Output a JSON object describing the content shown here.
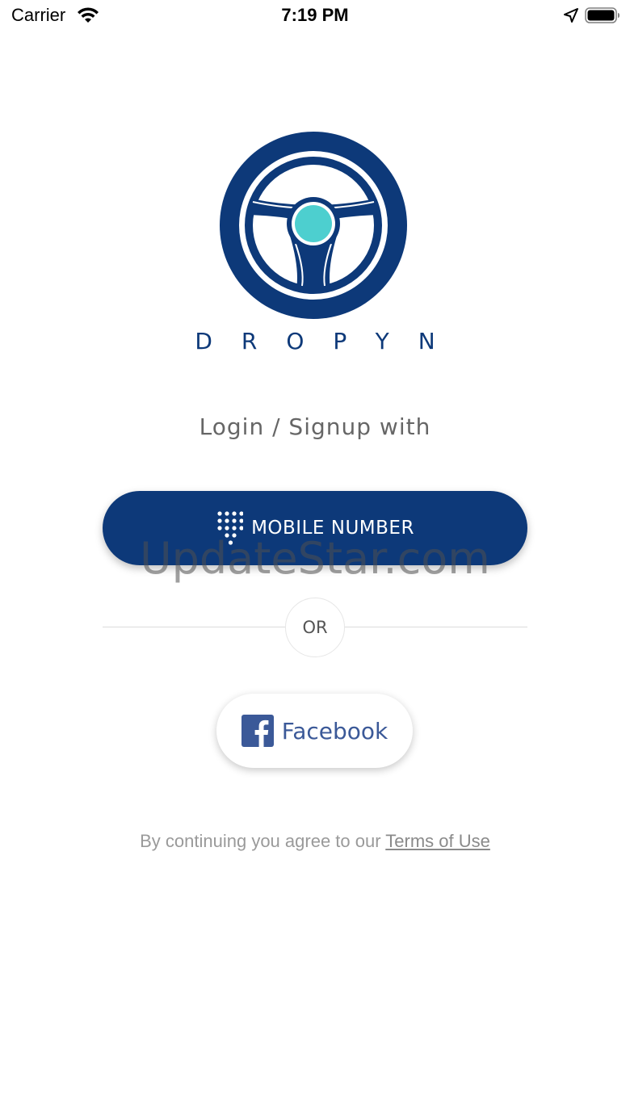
{
  "status_bar": {
    "carrier": "Carrier",
    "time": "7:19 PM",
    "icons": [
      "wifi-icon",
      "location-arrow-icon",
      "battery-icon"
    ]
  },
  "brand": {
    "name": "DROPYN",
    "logo_icon": "steering-wheel-icon",
    "primary_color": "#0d3979",
    "accent_color": "#4dcfcf"
  },
  "login": {
    "prompt": "Login / Signup with",
    "mobile_button_label": "MOBILE NUMBER",
    "mobile_button_icon": "dialpad-icon",
    "or_label": "OR",
    "facebook_button_label": "Facebook",
    "facebook_icon": "facebook-logo-icon",
    "facebook_color": "#3b5998"
  },
  "footer": {
    "terms_prefix": "By continuing you agree to our",
    "terms_link": "Terms of Use"
  },
  "watermark": "UpdateStar.com"
}
